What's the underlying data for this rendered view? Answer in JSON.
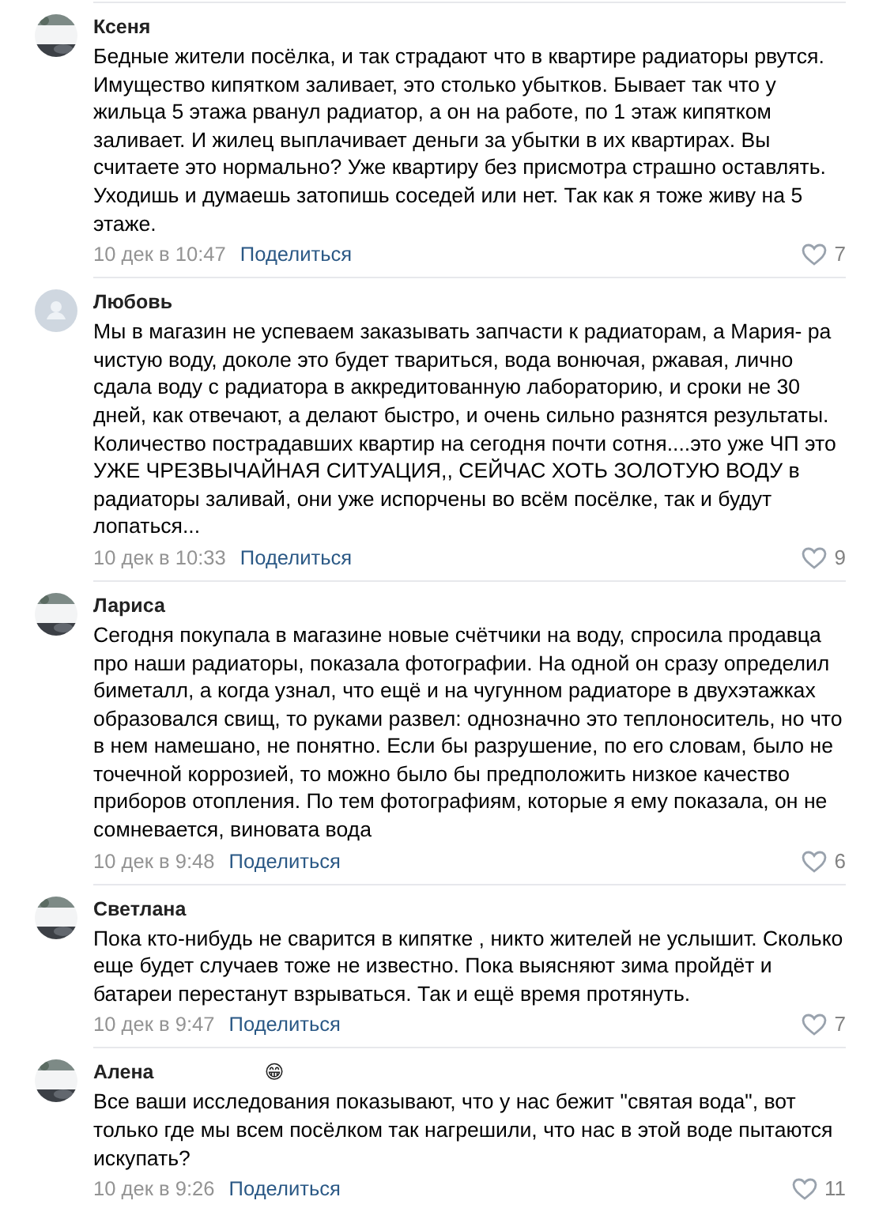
{
  "comments": [
    {
      "author": "Ксеня",
      "text": "Бедные жители посёлка, и так страдают что в квартире радиаторы рвутся. Имущество кипятком заливает, это столько убытков. Бывает так что у жильца 5 этажа рванул радиатор, а он на работе, по 1 этаж кипятком заливает. И жилец выплачивает деньги за убытки в их квартирах. Вы считаете это нормально? Уже квартиру без присмотра страшно оставлять. Уходишь и думаешь затопишь соседей или нет. Так как я тоже живу на 5 этаже.",
      "date": "10 дек в 10:47",
      "share": "Поделиться",
      "likes": "7"
    },
    {
      "author": "Любовь",
      "avatar": {
        "kind": "default"
      },
      "text": "Мы в магазин не успеваем заказывать запчасти к радиаторам, а Мария- ра чистую воду, доколе это будет твариться, вода вонючая, ржавая, лично сдала воду с радиатора в аккредитованную лабораторию, и сроки не 30 дней, как отвечают, а делают быстро, и очень сильно разнятся результаты. Количество пострадавших квартир на сегодня почти сотня....это уже ЧП это УЖЕ ЧРЕЗВЫЧАЙНАЯ СИТУАЦИЯ,, СЕЙЧАС ХОТЬ ЗОЛОТУЮ ВОДУ в радиаторы заливай, они уже испорчены во всём посёлке, так и будут лопаться...",
      "date": "10 дек в 10:33",
      "share": "Поделиться",
      "likes": "9"
    },
    {
      "author": "Лариса",
      "text": "Сегодня покупала в магазине новые счётчики на воду, спросила продавца про наши радиаторы, показала фотографии. На одной он сразу определил биметалл, а когда узнал, что ещё и на чугунном радиаторе в двухэтажках образовался свищ, то руками развел: однозначно это теплоноситель, но что в нем намешано, не понятно. Если бы разрушение, по его словам, было не точечной коррозией, то можно было бы предположить низкое качество приборов отопления. По тем фотографиям, которые я ему показала, он не сомневается, виновата вода",
      "date": "10 дек в 9:48",
      "share": "Поделиться",
      "likes": "6"
    },
    {
      "author": "Светлана",
      "text": "Пока кто-нибудь не сварится в кипятке , никто жителей не услышит. Сколько еще будет случаев тоже не известно. Пока выясняют зима пройдёт и батареи перестанут взрываться. Так и ещё время протянуть.",
      "date": "10 дек в 9:47",
      "share": "Поделиться",
      "likes": "7"
    },
    {
      "author": "Алена",
      "author_emoji": "😁",
      "text": "Все ваши исследования показывают, что у нас бежит \"святая вода\", вот только где мы всем посёлком так нагрешили, что нас в этой воде пытаются искупать?",
      "date": "10 дек в 9:26",
      "share": "Поделиться",
      "likes": "11"
    }
  ]
}
